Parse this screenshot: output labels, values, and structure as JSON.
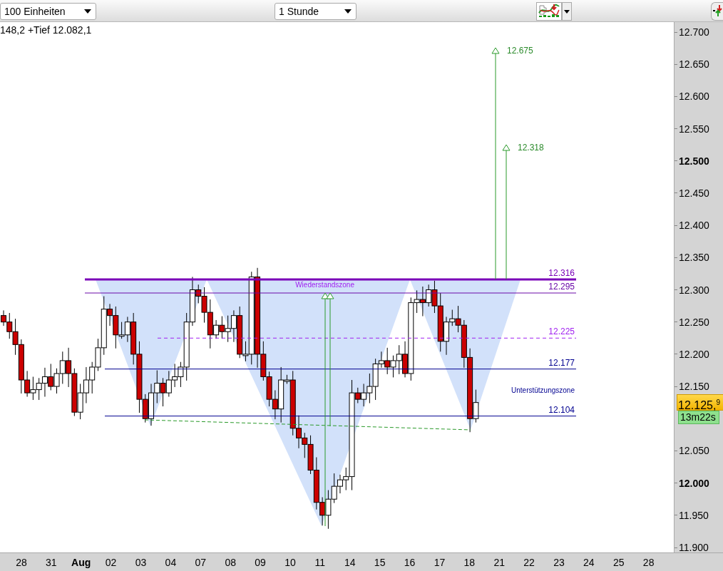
{
  "toolbar": {
    "units_dropdown": {
      "value": "100 Einheiten"
    },
    "interval_dropdown": {
      "value": "1 Stunde"
    }
  },
  "chart": {
    "info_text": "148,2 +Tief 12.082,1",
    "levels": [
      {
        "label": "12.316",
        "kind": "thick",
        "color": "#7a00b8"
      },
      {
        "label": "12.295",
        "kind": "solid",
        "color": "#6a0aa8"
      },
      {
        "label": "12.225",
        "kind": "dashed",
        "color": "#a020f0"
      },
      {
        "label": "12.177",
        "kind": "solid",
        "color": "#000090"
      },
      {
        "label": "12.104",
        "kind": "solid",
        "color": "#000090"
      }
    ],
    "zone_labels": [
      {
        "text": "Wiederstandszone",
        "kind": "resistance"
      },
      {
        "text": "Unterstützungszone",
        "kind": "support"
      }
    ],
    "targets": [
      "12.675",
      "12.318"
    ]
  },
  "y_axis": {
    "labels": [
      {
        "text": "12.700",
        "bold": false
      },
      {
        "text": "12.650",
        "bold": false
      },
      {
        "text": "12.600",
        "bold": false
      },
      {
        "text": "12.550",
        "bold": false
      },
      {
        "text": "12.500",
        "bold": true
      },
      {
        "text": "12.450",
        "bold": false
      },
      {
        "text": "12.400",
        "bold": false
      },
      {
        "text": "12.350",
        "bold": false
      },
      {
        "text": "12.300",
        "bold": false
      },
      {
        "text": "12.250",
        "bold": false
      },
      {
        "text": "12.200",
        "bold": false
      },
      {
        "text": "12.150",
        "bold": false
      },
      {
        "text": "12.050",
        "bold": false
      },
      {
        "text": "12.000",
        "bold": true
      },
      {
        "text": "11.950",
        "bold": false
      },
      {
        "text": "11.900",
        "bold": false
      }
    ],
    "current_price": "12.125,$^{9}$",
    "countdown": "13m22s"
  },
  "x_axis": {
    "labels": [
      {
        "text": "28",
        "bold": false
      },
      {
        "text": "31",
        "bold": false
      },
      {
        "text": "Aug",
        "bold": true
      },
      {
        "text": "02",
        "bold": false
      },
      {
        "text": "03",
        "bold": false
      },
      {
        "text": "04",
        "bold": false
      },
      {
        "text": "07",
        "bold": false
      },
      {
        "text": "08",
        "bold": false
      },
      {
        "text": "09",
        "bold": false
      },
      {
        "text": "10",
        "bold": false
      },
      {
        "text": "11",
        "bold": false
      },
      {
        "text": "14",
        "bold": false
      },
      {
        "text": "15",
        "bold": false
      },
      {
        "text": "16",
        "bold": false
      },
      {
        "text": "17",
        "bold": false
      },
      {
        "text": "18",
        "bold": false
      },
      {
        "text": "21",
        "bold": false
      },
      {
        "text": "22",
        "bold": false
      },
      {
        "text": "23",
        "bold": false
      },
      {
        "text": "24",
        "bold": false
      },
      {
        "text": "25",
        "bold": false
      },
      {
        "text": "28",
        "bold": false
      }
    ]
  }
}
